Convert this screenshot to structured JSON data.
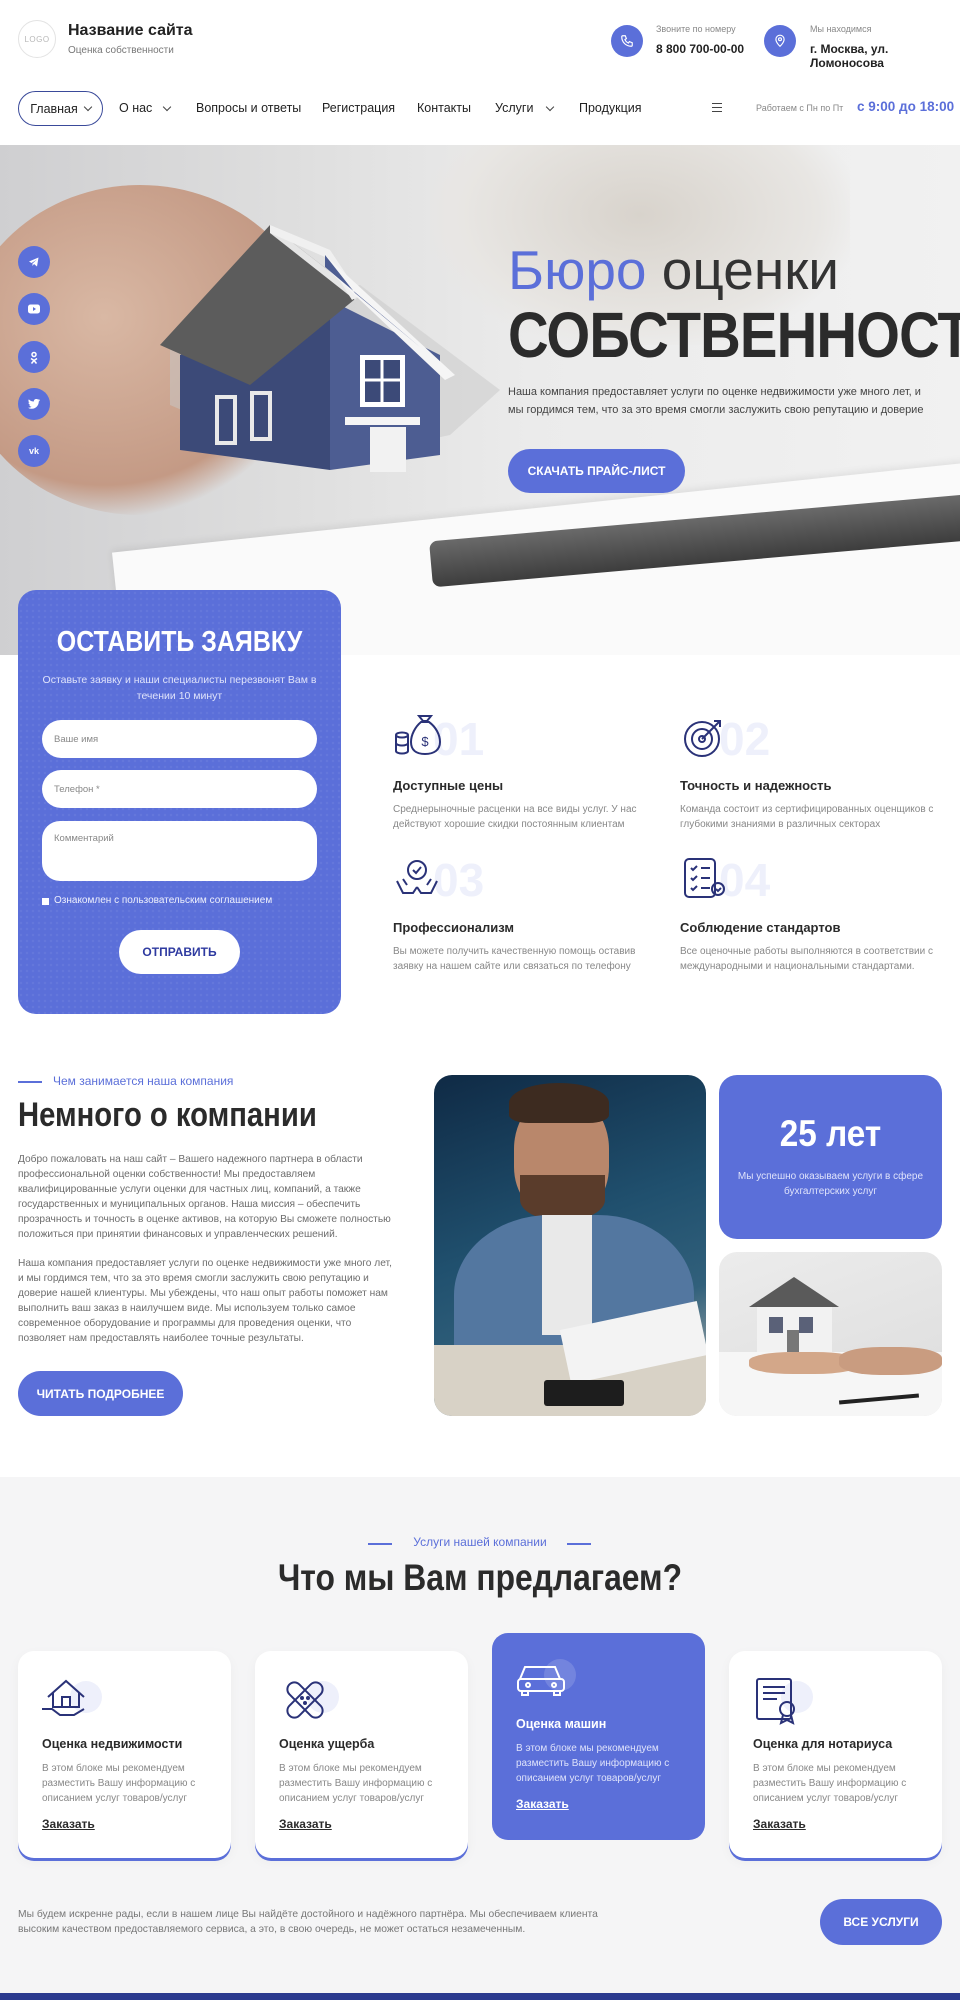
{
  "header": {
    "logo_text": "LOGO",
    "site_title": "Название сайта",
    "site_subtitle": "Оценка собственности",
    "phone_label": "Звоните по номеру",
    "phone": "8 800 700-00-00",
    "location_label": "Мы находимся",
    "address": "г. Москва, ул. Ломоносова"
  },
  "nav": {
    "items": [
      {
        "label": "Главная",
        "dropdown": true
      },
      {
        "label": "О нас",
        "dropdown": true
      },
      {
        "label": "Вопросы и ответы",
        "dropdown": false
      },
      {
        "label": "Регистрация",
        "dropdown": false
      },
      {
        "label": "Контакты",
        "dropdown": false
      },
      {
        "label": "Услуги",
        "dropdown": true
      },
      {
        "label": "Продукция",
        "dropdown": false
      }
    ],
    "hours_label": "Работаем с Пн по Пт",
    "hours": "с 9:00 до 18:00"
  },
  "hero": {
    "title_accent": "Бюро",
    "title_rest": " оценки",
    "title_line2": "СОБСТВЕННОСТИ",
    "text": "Наша компания предоставляет услуги по оценке недвижимости уже много лет, и мы гордимся тем, что за это время смогли заслужить свою репутацию и доверие",
    "button": "СКАЧАТЬ ПРАЙС-ЛИСТ",
    "social_icons": [
      "telegram-icon",
      "youtube-icon",
      "odnoklassniki-icon",
      "twitter-icon",
      "vk-icon"
    ]
  },
  "form": {
    "title": "ОСТАВИТЬ ЗАЯВКУ",
    "subtitle": "Оставьте заявку и наши специалисты перезвонят  Вам в течении 10 минут",
    "name_placeholder": "Ваше имя",
    "phone_placeholder": "Телефон *",
    "comment_placeholder": "Комментарий",
    "agreement": "Ознакомлен с пользовательским соглашением",
    "submit": "ОТПРАВИТЬ"
  },
  "features": [
    {
      "num": "01",
      "title": "Доступные цены",
      "text": "Среднерыночные расценки на все виды услуг. У нас действуют хорошие скидки постоянным клиентам",
      "icon": "money-bag-icon"
    },
    {
      "num": "02",
      "title": "Точность и надежность",
      "text": "Команда состоит из сертифицированных оценщиков с глубокими знаниями в различных секторах",
      "icon": "target-icon"
    },
    {
      "num": "03",
      "title": "Профессионализм",
      "text": "Вы можете получить качественную помощь оставив заявку на нашем сайте или связаться по телефону",
      "icon": "hands-award-icon"
    },
    {
      "num": "04",
      "title": "Соблюдение стандартов",
      "text": "Все оценочные работы выполняются в соответствии с международными и национальными стандартами.",
      "icon": "checklist-icon"
    }
  ],
  "about": {
    "kicker": "Чем занимается наша компания",
    "title": "Немного о компании",
    "p1": "Добро пожаловать на наш сайт – Вашего надежного партнера в области профессиональной оценки собственности! Мы предоставляем квалифицированные услуги оценки для частных лиц, компаний, а также государственных и муниципальных органов. Наша миссия – обеспечить прозрачность и точность в оценке активов, на которую Вы сможете полностью положиться при принятии финансовых и управленческих решений.",
    "p2": "Наша компания предоставляет услуги по оценке недвижимости уже много лет, и мы гордимся тем, что за это время смогли заслужить свою репутацию и доверие нашей клиентуры. Мы убеждены, что наш опыт работы  поможет нам выполнить ваш заказ в наилучшем виде. Мы используем только самое современное оборудование и программы для проведения оценки, что позволяет нам предоставлять наиболее точные результаты.",
    "button": "ЧИТАТЬ ПОДРОБНЕЕ",
    "years": "25 лет",
    "years_text": "Мы успешно оказываем услуги в сфере бухгалтерских услуг"
  },
  "services": {
    "kicker": "Услуги нашей компании",
    "title": "Что мы Вам предлагаем?",
    "cards": [
      {
        "title": "Оценка недвижимости",
        "text": "В этом блоке мы рекомендуем разместить Вашу информацию с описанием услуг товаров/услуг",
        "link": "Заказать",
        "icon": "house-hand-icon"
      },
      {
        "title": "Оценка ущерба",
        "text": "В этом блоке мы рекомендуем разместить Вашу информацию с описанием услуг товаров/услуг",
        "link": "Заказать",
        "icon": "bandage-icon"
      },
      {
        "title": "Оценка машин",
        "text": "В этом блоке мы рекомендуем разместить Вашу информацию с описанием услуг товаров/услуг",
        "link": "Заказать",
        "icon": "car-icon"
      },
      {
        "title": "Оценка для нотариуса",
        "text": "В этом блоке мы рекомендуем разместить Вашу информацию с описанием услуг товаров/услуг",
        "link": "Заказать",
        "icon": "certificate-icon"
      }
    ],
    "bottom_text": "Мы будем искренне рады, если в нашем лице Вы найдёте достойного и надёжного партнёра. Мы обеспечиваем клиента высоким качеством предоставляемого сервиса, а это, в свою очередь, не может остаться незамеченным.",
    "all_button": "ВСЕ УСЛУГИ"
  },
  "colors": {
    "accent": "#5b6fd9",
    "dark": "#2b2b2b",
    "footer": "#2b3a8f"
  }
}
